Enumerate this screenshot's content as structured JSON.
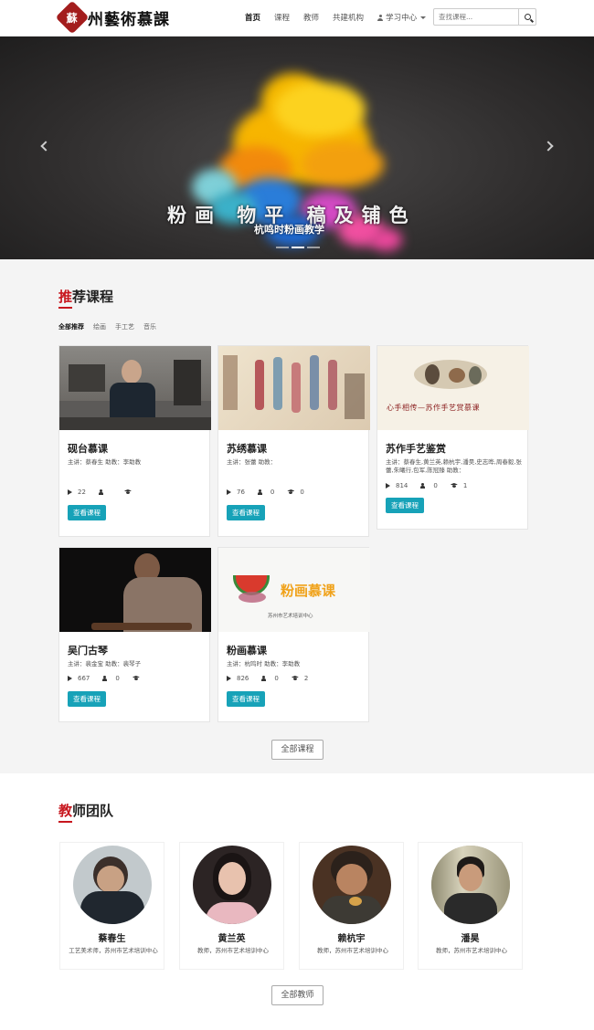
{
  "header": {
    "logo_seal": "蘇",
    "logo_text": "州藝術慕課",
    "nav": [
      {
        "label": "首页",
        "active": true
      },
      {
        "label": "课程",
        "active": false
      },
      {
        "label": "教师",
        "active": false
      },
      {
        "label": "共建机构",
        "active": false
      }
    ],
    "learning_center": "学习中心",
    "search_placeholder": "查找课程..."
  },
  "banner": {
    "title": "粉画 物平 稿及铺色",
    "subtitle": "杭鸣时粉画教学",
    "slides": 3,
    "active_slide": 2
  },
  "courses": {
    "title_first": "推",
    "title_rest": "荐课程",
    "filters": [
      "全部推荐",
      "绘画",
      "手工艺",
      "音乐"
    ],
    "active_filter": 0,
    "items": [
      {
        "name": "砚台慕课",
        "meta": "主讲：蔡春生    助教：李助教",
        "plays": "22",
        "students": "",
        "certs": ""
      },
      {
        "name": "苏绣慕课",
        "meta": "主讲：张蕾    助教：",
        "plays": "76",
        "students": "0",
        "certs": "0"
      },
      {
        "name": "苏作手艺鉴赏",
        "meta": "主讲：蔡春生,黄兰英,赖杭宇,潘昊,史志晔,周春毅,张蕾,朱曦行,包军,陈冠臻    助教：",
        "plays": "814",
        "students": "0",
        "certs": "1",
        "thumb_text": "心手相传—苏作手艺赏慕课"
      },
      {
        "name": "吴门古琴",
        "meta": "主讲：裴金宝    助教：裴琴子",
        "plays": "667",
        "students": "0",
        "certs": ""
      },
      {
        "name": "粉画慕课",
        "meta": "主讲：杭鸣时    助教：李助教",
        "plays": "826",
        "students": "0",
        "certs": "2",
        "thumb_title": "粉画慕课",
        "thumb_sub": "苏州市艺术培训中心"
      }
    ],
    "view_label": "查看课程",
    "all_label": "全部课程"
  },
  "teachers": {
    "title_first": "教",
    "title_rest": "师团队",
    "items": [
      {
        "name": "蔡春生",
        "desc": "工艺美术师，苏州市艺术培训中心"
      },
      {
        "name": "黄兰英",
        "desc": "教师，苏州市艺术培训中心"
      },
      {
        "name": "赖杭宇",
        "desc": "教师，苏州市艺术培训中心"
      },
      {
        "name": "潘昊",
        "desc": "教师，苏州市艺术培训中心"
      }
    ],
    "all_label": "全部教师"
  },
  "colors": {
    "accent_red": "#c7161e",
    "button_teal": "#17a2b8"
  }
}
